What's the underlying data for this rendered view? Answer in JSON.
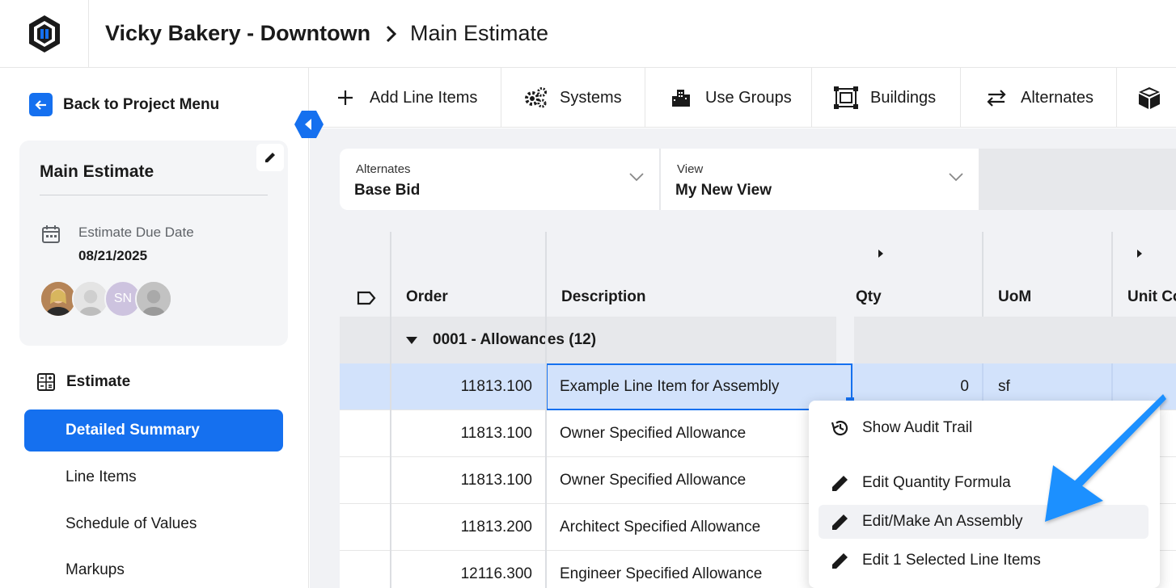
{
  "header": {
    "project_name": "Vicky Bakery - Downtown",
    "page_name": "Main Estimate"
  },
  "sidebar": {
    "back_label": "Back to Project Menu",
    "estimate_card": {
      "title": "Main Estimate",
      "due_label": "Estimate Due Date",
      "due_date": "08/21/2025",
      "avatars": [
        {
          "initials": ""
        },
        {
          "initials": ""
        },
        {
          "initials": "SN"
        },
        {
          "initials": ""
        }
      ]
    },
    "section_title": "Estimate",
    "nav": [
      {
        "label": "Detailed Summary",
        "active": true
      },
      {
        "label": "Line Items"
      },
      {
        "label": "Schedule of Values"
      },
      {
        "label": "Markups"
      }
    ]
  },
  "toolbar": {
    "add_line_items": "Add Line Items",
    "systems": "Systems",
    "use_groups": "Use Groups",
    "buildings": "Buildings",
    "alternates": "Alternates"
  },
  "filters": {
    "alternates": {
      "label": "Alternates",
      "value": "Base Bid"
    },
    "view": {
      "label": "View",
      "value": "My New View"
    }
  },
  "grid": {
    "columns": {
      "order": "Order",
      "description": "Description",
      "qty": "Qty",
      "uom": "UoM",
      "unit_cost": "Unit Co"
    },
    "group": {
      "label": "0001 - Allowances (12)"
    },
    "rows": [
      {
        "order": "11813.100",
        "description": "Example Line Item for Assembly",
        "qty": "0",
        "uom": "sf"
      },
      {
        "order": "11813.100",
        "description": "Owner Specified Allowance"
      },
      {
        "order": "11813.100",
        "description": "Owner Specified Allowance"
      },
      {
        "order": "11813.200",
        "description": "Architect Specified Allowance"
      },
      {
        "order": "12116.300",
        "description": "Engineer Specified Allowance"
      }
    ]
  },
  "context_menu": {
    "items": [
      {
        "label": "Show Audit Trail",
        "icon": "history-icon"
      },
      {
        "label": "Edit Quantity Formula",
        "icon": "pencil-icon"
      },
      {
        "label": "Edit/Make An Assembly",
        "icon": "pencil-icon"
      },
      {
        "label": "Edit 1 Selected Line Items",
        "icon": "pencil-icon"
      }
    ]
  },
  "colors": {
    "accent": "#1570ef",
    "selected_row": "#d2e2fb",
    "annotation_arrow": "#1e90ff"
  }
}
